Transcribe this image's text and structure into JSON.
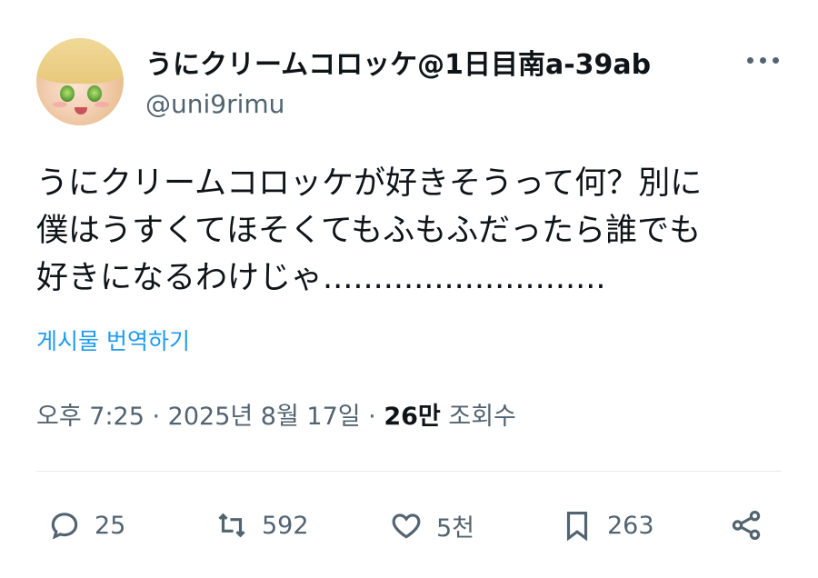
{
  "author": {
    "display_name": "うにクリームコロッケ@1日目南a-39ab",
    "handle": "@uni9rimu"
  },
  "tweet": {
    "lines": [
      "うにクリームコロッケが好きそうって何？別に",
      "僕はうすくてほそくてもふもふだったら誰でも",
      "好きになるわけじゃ............................"
    ],
    "translate_label": "게시물 번역하기"
  },
  "meta": {
    "time": "오후 7:25",
    "sep1": " · ",
    "date": "2025년 8월 17일",
    "sep2": " · ",
    "views_count": "26만",
    "views_label": " 조회수"
  },
  "actions": {
    "reply_count": "25",
    "retweet_count": "592",
    "like_count": "5천",
    "bookmark_count": "263"
  },
  "icons": [
    "more-icon",
    "reply-icon",
    "retweet-icon",
    "like-icon",
    "bookmark-icon",
    "share-icon"
  ],
  "colors": {
    "text": "#0f1419",
    "secondary": "#536471",
    "link": "#1d9bf0"
  }
}
